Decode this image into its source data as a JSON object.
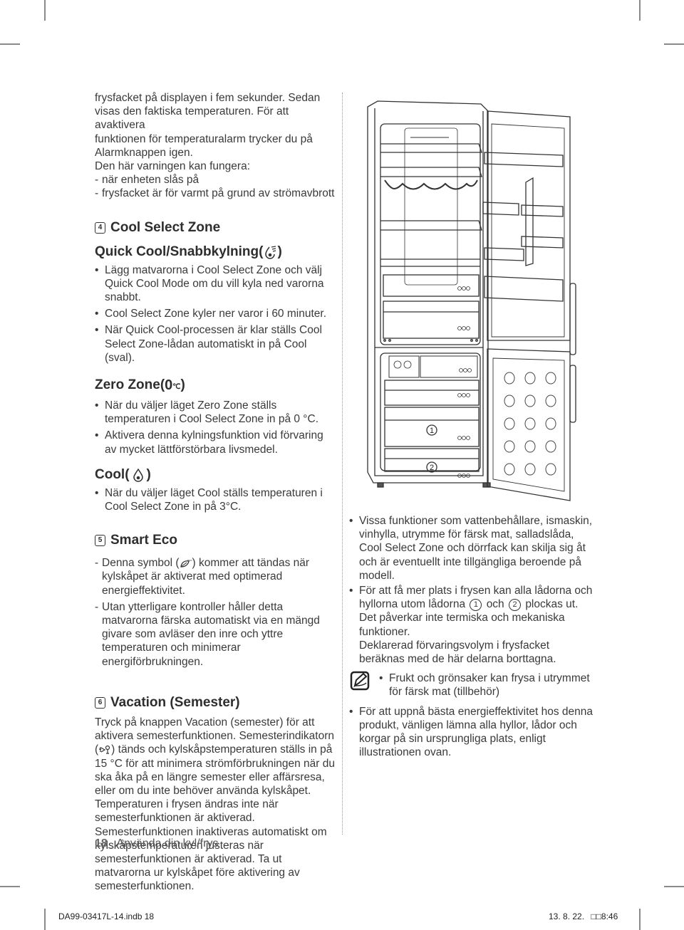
{
  "left_column": {
    "intro_paragraph": [
      "frysfacket på displayen i fem sekunder. Sedan",
      "visas den faktiska temperaturen. För att avaktivera",
      "funktionen för temperaturalarm trycker du på",
      "Alarmknappen igen."
    ],
    "warning_lead": "Den här varningen kan fungera:",
    "warning_items": [
      "när enheten slås på",
      "frysfacket är för varmt på grund av strömavbrott"
    ],
    "section4": {
      "number": "4",
      "title": "Cool Select Zone",
      "quick_cool": {
        "heading": "Quick Cool/Snabbkylning(",
        "heading_close": ")",
        "icon": "quick-cool-icon",
        "bullets": [
          "Lägg matvarorna i Cool Select Zone och välj Quick Cool Mode om du vill kyla ned varorna snabbt.",
          "Cool Select Zone kyler ner varor i 60 minuter.",
          "När Quick Cool-processen är klar ställs Cool Select Zone-lådan automatiskt in på Cool (sval)."
        ]
      },
      "zero_zone": {
        "heading": "Zero Zone(",
        "heading_symbol": "0",
        "heading_unit": "℃",
        "heading_close": ")",
        "bullets": [
          "När du väljer läget Zero Zone ställs temperaturen i Cool Select Zone in på 0 °C.",
          "Aktivera denna kylningsfunktion vid förvaring av mycket lättförstörbara livsmedel."
        ]
      },
      "cool": {
        "heading": "Cool(",
        "heading_close": ")",
        "icon": "cool-drop-icon",
        "bullets": [
          "När du väljer läget Cool ställs temperaturen i Cool Select Zone in på  3°C."
        ]
      }
    },
    "section5": {
      "number": "5",
      "title": "Smart Eco",
      "items": [
        {
          "before": "Denna symbol (",
          "icon": "eco-leaf-icon",
          "after": ") kommer att tändas när kylskåpet är aktiverat med optimerad energieffektivitet."
        },
        {
          "before": "Utan ytterligare kontroller håller detta matvarorna färska automatiskt via en mängd givare som avläser den inre och yttre temperaturen och minimerar energiförbrukningen.",
          "icon": "",
          "after": ""
        }
      ]
    },
    "section6": {
      "number": "6",
      "title": "Vacation (Semester)",
      "para_before_icon": "Tryck på knappen Vacation (semester) för att aktivera semesterfunktionen. Semesterindikatorn (",
      "icon": "vacation-icon",
      "para_after_icon": ") tänds och kylskåpstemperaturen ställs in på 15 °C för att minimera strömförbrukningen när du ska åka på en längre semester eller affärsresa, eller om du inte behöver använda kylskåpet. Temperaturen i frysen ändras inte när semesterfunktionen är aktiverad. Semesterfunktionen inaktiveras automatiskt om kylskåpstemperaturen justeras när semesterfunktionen är aktiverad. Ta ut matvarorna ur kylskåpet före aktivering av semesterfunktionen."
    }
  },
  "right_column": {
    "bullet1": "Vissa funktioner som vattenbehållare, ismaskin, vinhylla, utrymme för färsk mat, salladslåda, Cool Select Zone och dörrfack kan skilja sig åt och är eventuellt inte tillgängliga beroende på modell.",
    "bullet2_before": "För att få mer plats i frysen kan alla lådorna och hyllorna utom lådorna",
    "bullet2_mark1": "1",
    "bullet2_mid": "och",
    "bullet2_mark2": "2",
    "bullet2_after": "plockas ut. Det påverkar inte termiska och mekaniska funktioner.",
    "bullet2_extra": "Deklarerad förvaringsvolym i frysfacket beräknas med de här delarna borttagna.",
    "note": "Frukt och grönsaker kan frysa i utrymmet för färsk mat (tillbehör)",
    "note_icon": "note-pencil-icon",
    "bullet3": "För att uppnå bästa energieffektivitet hos denna produkt, vänligen lämna alla hyllor, lådor och korgar på sin ursprungliga plats, enligt illustrationen ovan."
  },
  "illustration": {
    "subject": "refrigerator-freezer-open-doors",
    "drawer_labels": [
      "1",
      "2"
    ],
    "door_bins": 15
  },
  "footer": {
    "page_number": "18_",
    "section_title": "Använda din kyl/frys",
    "slug_file": "DA99-03417L-14.indb   18",
    "slug_date": "13. 8. 22.",
    "slug_time_glyph": "□□",
    "slug_time": "8:46"
  }
}
